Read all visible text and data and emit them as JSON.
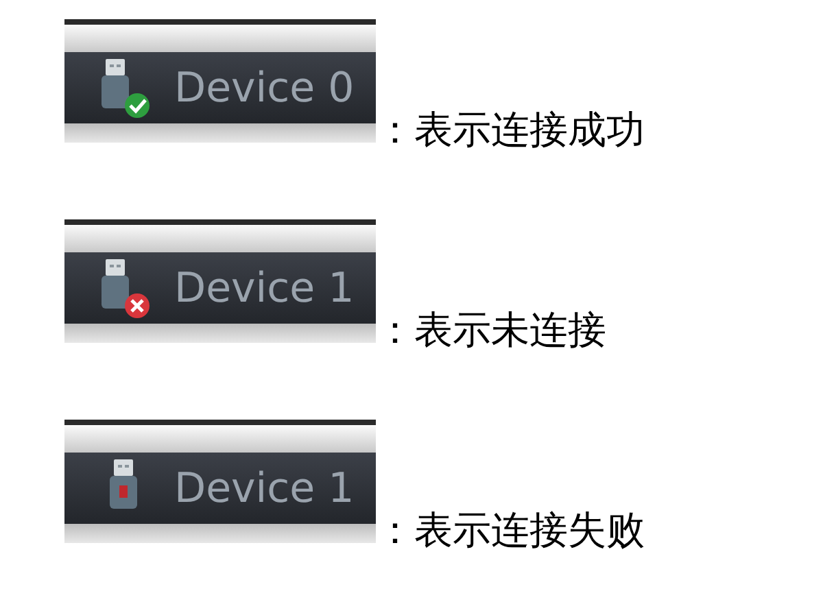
{
  "legend": [
    {
      "device": {
        "label": "Device 0",
        "kind": "connected"
      },
      "caption": "：表示连接成功"
    },
    {
      "device": {
        "label": "Device 1",
        "kind": "disconnected"
      },
      "caption": "：表示未连接"
    },
    {
      "device": {
        "label": "Device 1",
        "kind": "failed"
      },
      "caption": "：表示连接失败"
    }
  ]
}
